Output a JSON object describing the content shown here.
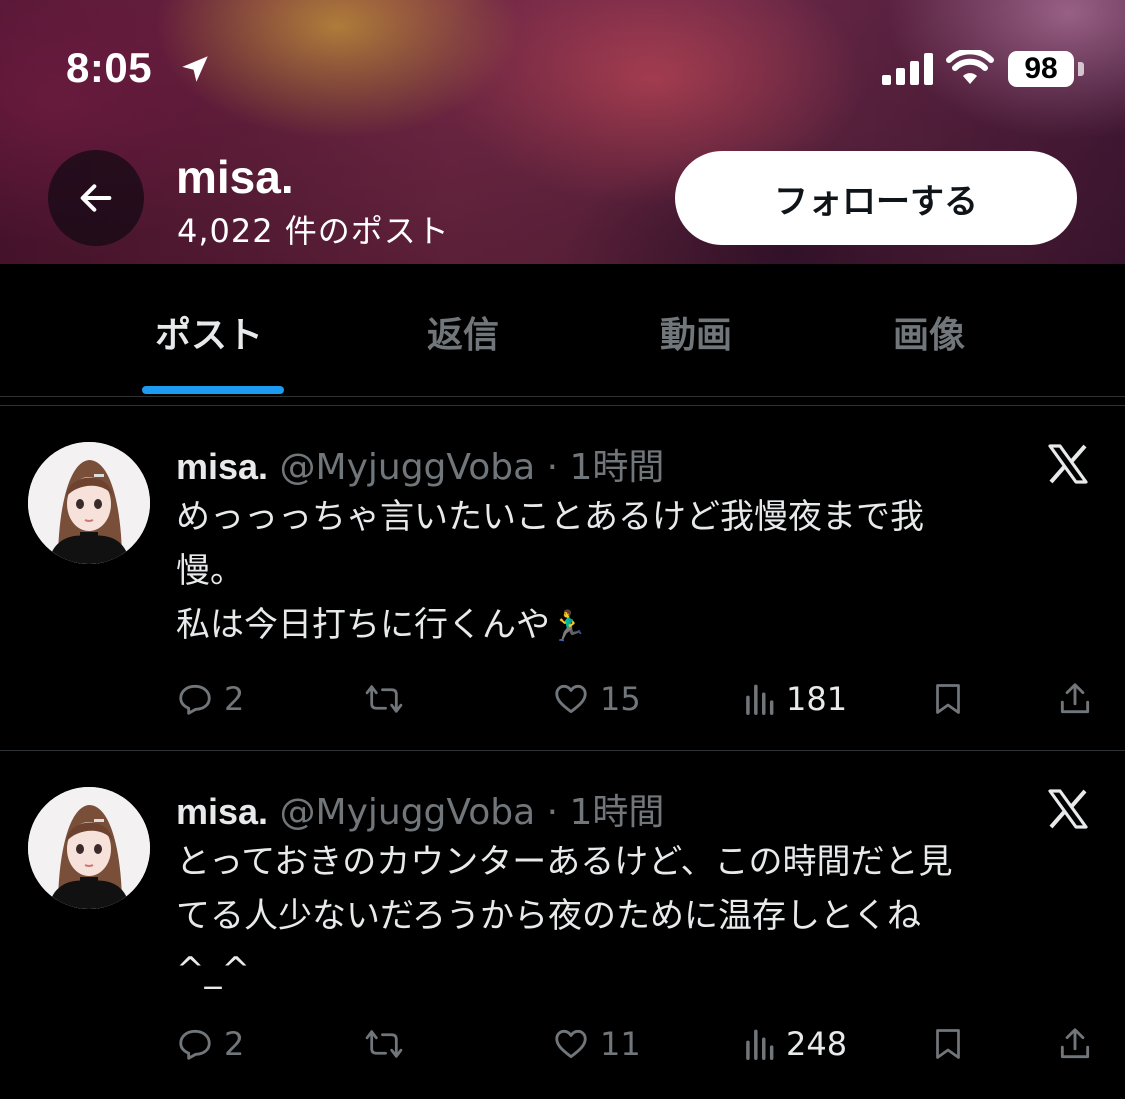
{
  "status_bar": {
    "time": "8:05",
    "battery": "98",
    "icons": [
      "location-arrow-icon",
      "cellular-signal-icon",
      "wifi-icon",
      "battery-icon"
    ]
  },
  "profile_header": {
    "name": "misa.",
    "post_count": "4,022 件のポスト",
    "follow_label": "フォローする",
    "back_icon": "arrow-left-icon"
  },
  "tabs": [
    {
      "label": "ポスト",
      "active": true
    },
    {
      "label": "返信",
      "active": false
    },
    {
      "label": "動画",
      "active": false
    },
    {
      "label": "画像",
      "active": false
    }
  ],
  "colors": {
    "accent": "#1d9bf0",
    "background": "#000000",
    "secondary_text": "#71767b",
    "primary_text": "#e7e9ea"
  },
  "posts": [
    {
      "author": "misa.",
      "handle": "@MyjuggVoba",
      "separator": "·",
      "time": "1時間",
      "lines": [
        "めっっっちゃ言いたいことあるけど我慢夜まで我",
        "慢。",
        "私は今日打ちに行くんや"
      ],
      "emoji": "🏃‍♂️",
      "replies": "2",
      "reposts": "",
      "likes": "15",
      "views": "181"
    },
    {
      "author": "misa.",
      "handle": "@MyjuggVoba",
      "separator": "·",
      "time": "1時間",
      "lines": [
        "とっておきのカウンターあるけど、この時間だと見",
        "てる人少ないだろうから夜のために温存しとくね",
        "^_^"
      ],
      "emoji": "",
      "replies": "2",
      "reposts": "",
      "likes": "11",
      "views": "248"
    }
  ]
}
